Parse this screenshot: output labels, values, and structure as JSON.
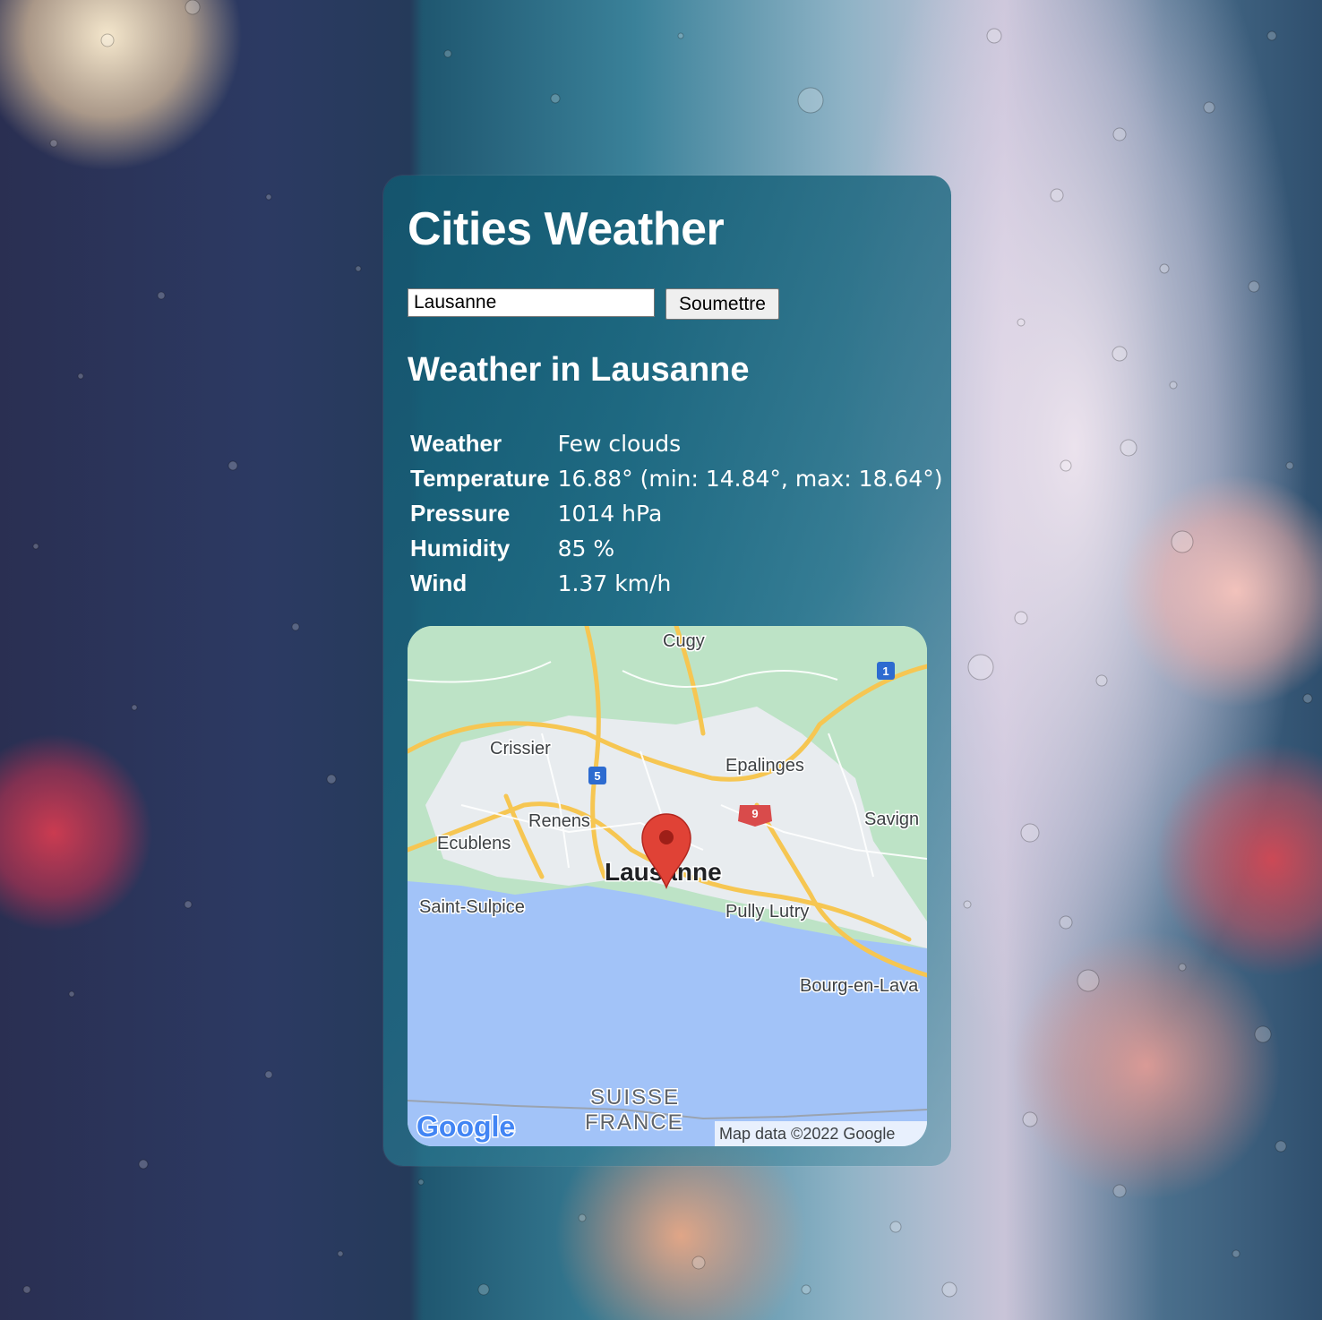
{
  "app": {
    "title": "Cities Weather"
  },
  "search": {
    "value": "Lausanne",
    "submit_label": "Soumettre"
  },
  "weather": {
    "heading": "Weather in Lausanne",
    "rows": [
      {
        "label": "Weather",
        "value": "Few clouds"
      },
      {
        "label": "Temperature",
        "value": "16.88° (min: 14.84°, max: 18.64°)"
      },
      {
        "label": "Pressure",
        "value": "1014 hPa"
      },
      {
        "label": "Humidity",
        "value": "85 %"
      },
      {
        "label": "Wind",
        "value": "1.37 km/h"
      }
    ]
  },
  "map": {
    "labels": {
      "cugy": "Cugy",
      "crissier": "Crissier",
      "epalinges": "Epalinges",
      "renens": "Renens",
      "savigny": "Savign",
      "ecublens": "Ecublens",
      "lausanne": "Lausanne",
      "saint_sulpice": "Saint-Sulpice",
      "pully_lutry": "Pully Lutry",
      "bourg": "Bourg-en-Lava",
      "suisse": "SUISSE",
      "france": "FRANCE"
    },
    "shields": {
      "a1": "1",
      "a5": "5",
      "a9": "9"
    },
    "logo": "Google",
    "attribution": "Map data ©2022 Google",
    "colors": {
      "land": "#bde3c6",
      "urban": "#e8ecef",
      "water": "#a2c3f8",
      "road": "#f6c652",
      "marker": "#e04236"
    }
  }
}
